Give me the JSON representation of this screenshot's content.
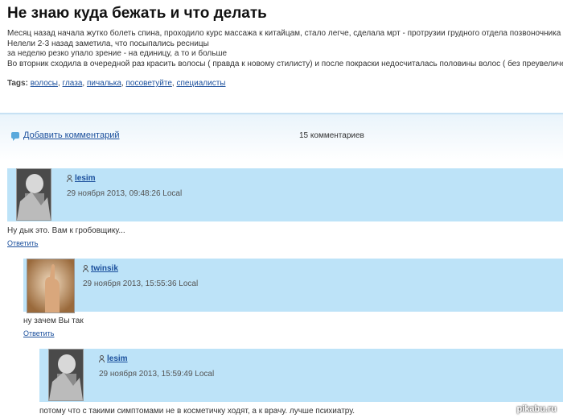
{
  "post": {
    "title": "Не знаю куда бежать и что делать",
    "lines": [
      "Месяц назад начала жутко болеть спина, проходило курс массажа к китайцам, стало легче, сделала мрт - протрузии грудного отдела позвоночника",
      "Нелели 2-3 назад заметила, что посыпались ресницы",
      "за неделю резко упало зрение - на единицу, а то и больше",
      "Во вторник сходила в очередной раз красить волосы ( правда к новому стилисту) и после покраски недосчиталась половины волос ( без преувеличений)"
    ],
    "tags_label": "Tags:",
    "tags": [
      "волосы",
      "глаза",
      "пичалька",
      "посоветуйте",
      "специалисты"
    ]
  },
  "comments_bar": {
    "add_label": "Добавить комментарий",
    "count_label": "15 комментариев",
    "icon": "comment-bubble-icon"
  },
  "comments": [
    {
      "author": "lesim",
      "date": "29 ноября 2013, 09:48:26 Local",
      "text": "Ну дык это. Вам к гробовщику...",
      "reply": "Ответить"
    },
    {
      "author": "twinsik",
      "date": "29 ноября 2013, 15:55:36 Local",
      "text": "ну зачем Вы так",
      "reply": "Ответить"
    },
    {
      "author": "lesim",
      "date": "29 ноября 2013, 15:59:49 Local",
      "text": "потому что с такими симптомами не в косметичку ходят, а к врачу. лучше психиатру.",
      "reply": ""
    }
  ],
  "watermark": "pikabu.ru",
  "colors": {
    "link": "#1a4f9c",
    "comment_header": "#bde3f8",
    "icon": "#5aa9dc"
  }
}
